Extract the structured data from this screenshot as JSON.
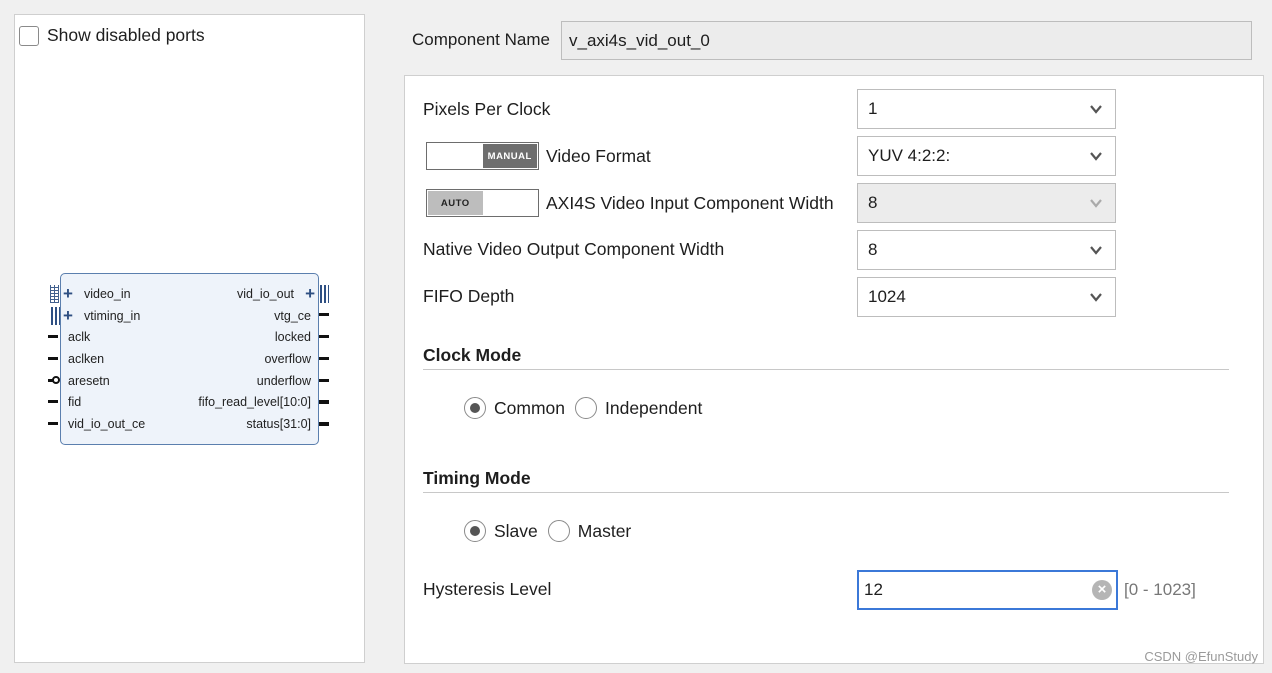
{
  "left_panel": {
    "show_disabled_label": "Show disabled ports",
    "show_disabled_checked": false,
    "block": {
      "left_ports": [
        "video_in",
        "vtiming_in",
        "aclk",
        "aclken",
        "aresetn",
        "fid",
        "vid_io_out_ce"
      ],
      "right_ports": [
        "vid_io_out",
        "vtg_ce",
        "locked",
        "overflow",
        "underflow",
        "fifo_read_level[10:0]",
        "status[31:0]"
      ]
    }
  },
  "component": {
    "label": "Component Name",
    "value": "v_axi4s_vid_out_0"
  },
  "config": {
    "pixels_per_clock": {
      "label": "Pixels Per Clock",
      "value": "1"
    },
    "video_format": {
      "label": "Video Format",
      "value": "YUV 4:2:2:",
      "mode": "MANUAL"
    },
    "axi4s_width": {
      "label": "AXI4S Video Input Component Width",
      "value": "8",
      "mode": "AUTO"
    },
    "native_width": {
      "label": "Native Video Output Component Width",
      "value": "8"
    },
    "fifo_depth": {
      "label": "FIFO Depth",
      "value": "1024"
    },
    "clock_mode": {
      "title": "Clock Mode",
      "options": [
        "Common",
        "Independent"
      ],
      "selected": "Common"
    },
    "timing_mode": {
      "title": "Timing Mode",
      "options": [
        "Slave",
        "Master"
      ],
      "selected": "Slave"
    },
    "hysteresis": {
      "label": "Hysteresis Level",
      "value": "12",
      "range": "[0 - 1023]"
    }
  },
  "watermark": "CSDN @EfunStudy",
  "colors": {
    "focus_border": "#3b78d8",
    "block_fill": "#eef3fa",
    "block_border": "#5b7fae"
  }
}
